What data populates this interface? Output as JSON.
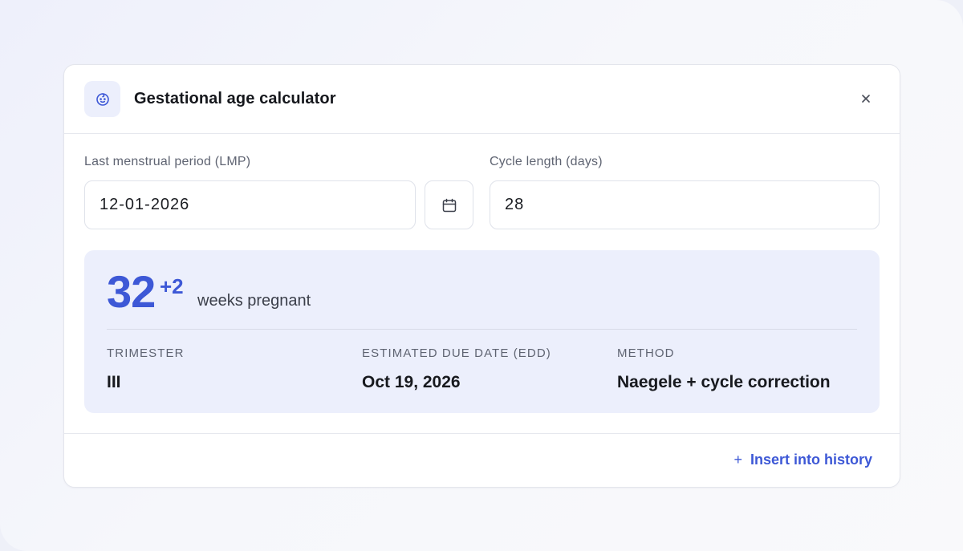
{
  "dialog": {
    "title": "Gestational age calculator",
    "icon": "baby-face-icon",
    "close_icon": "close-icon"
  },
  "form": {
    "lmp_label": "Last menstrual period (LMP)",
    "lmp_value": "12-01-2026",
    "calendar_icon": "calendar-icon",
    "cycle_label": "Cycle length (days)",
    "cycle_value": "28"
  },
  "result": {
    "weeks": "32",
    "days": "+2",
    "weeks_label": "weeks pregnant",
    "stats": [
      {
        "label": "TRIMESTER",
        "value": "III"
      },
      {
        "label": "ESTIMATED DUE DATE (EDD)",
        "value": "Oct 19, 2026"
      },
      {
        "label": "METHOD",
        "value": "Naegele + cycle correction"
      }
    ]
  },
  "footer": {
    "insert_plus": "+",
    "insert_label": "Insert into history"
  },
  "colors": {
    "accent": "#3d58d6",
    "result_bg": "#eceffc"
  }
}
